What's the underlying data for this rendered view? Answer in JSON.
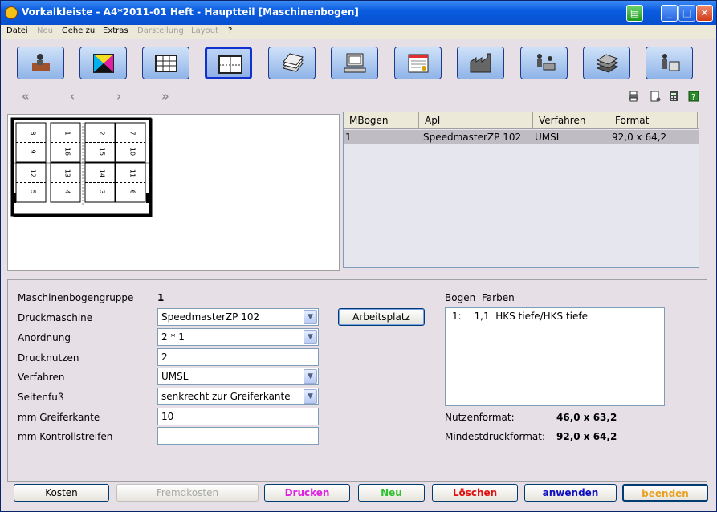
{
  "window": {
    "title": "Vorkalkleiste - A4*2011-01 Heft - Hauptteil [Maschinenbogen]"
  },
  "menu": [
    {
      "label": "Datei",
      "enabled": true
    },
    {
      "label": "Neu",
      "enabled": false
    },
    {
      "label": "Gehe zu",
      "enabled": true
    },
    {
      "label": "Extras",
      "enabled": true
    },
    {
      "label": "Darstellung",
      "enabled": false
    },
    {
      "label": "Layout",
      "enabled": false
    },
    {
      "label": "?",
      "enabled": true
    }
  ],
  "nav": {
    "first": "«",
    "prev": "‹",
    "next": "›",
    "last": "»"
  },
  "sheet_pages": [
    [
      "8",
      "1",
      "2",
      "7"
    ],
    [
      "9",
      "16",
      "15",
      "10"
    ],
    [
      "12",
      "13",
      "14",
      "11"
    ],
    [
      "5",
      "4",
      "3",
      "6"
    ]
  ],
  "grid": {
    "headers": [
      "MBogen",
      "Apl",
      "Verfahren",
      "Format"
    ],
    "rows": [
      [
        "1",
        "SpeedmasterZP 102",
        "UMSL",
        "92,0 x 64,2"
      ]
    ]
  },
  "form": {
    "maschinenbogengruppe_label": "Maschinenbogengruppe",
    "maschinenbogengruppe_value": "1",
    "druckmaschine_label": "Druckmaschine",
    "druckmaschine_value": "SpeedmasterZP 102",
    "anordnung_label": "Anordnung",
    "anordnung_value": "2 * 1",
    "drucknutzen_label": "Drucknutzen",
    "drucknutzen_value": "2",
    "verfahren_label": "Verfahren",
    "verfahren_value": "UMSL",
    "seitenfuss_label": "Seitenfuß",
    "seitenfuss_value": "senkrecht zur Greiferkante",
    "greiferkante_label": "mm Greiferkante",
    "greiferkante_value": "10",
    "kontrollstreifen_label": "mm Kontrollstreifen",
    "kontrollstreifen_value": "",
    "arbeitsplatz_label": "Arbeitsplatz",
    "bogen_label": "Bogen",
    "farben_label": "Farben",
    "farben_items": [
      {
        "index": "1:",
        "text": "1,1  HKS tiefe/HKS tiefe"
      }
    ],
    "nutzenformat_label": "Nutzenformat:",
    "nutzenformat_value": "46,0 x 63,2",
    "mindestdruckformat_label": "Mindestdruckformat:",
    "mindestdruckformat_value": "92,0 x 64,2"
  },
  "buttons": {
    "kosten": "Kosten",
    "fremdkosten": "Fremdkosten",
    "drucken": "Drucken",
    "neu": "Neu",
    "loeschen": "Löschen",
    "anwenden": "anwenden",
    "beenden": "beenden"
  },
  "colors": {
    "drucken": "#e020e0",
    "neu": "#30c030",
    "loeschen": "#e01010",
    "anwenden": "#1010c0",
    "beenden": "#e8a020"
  }
}
